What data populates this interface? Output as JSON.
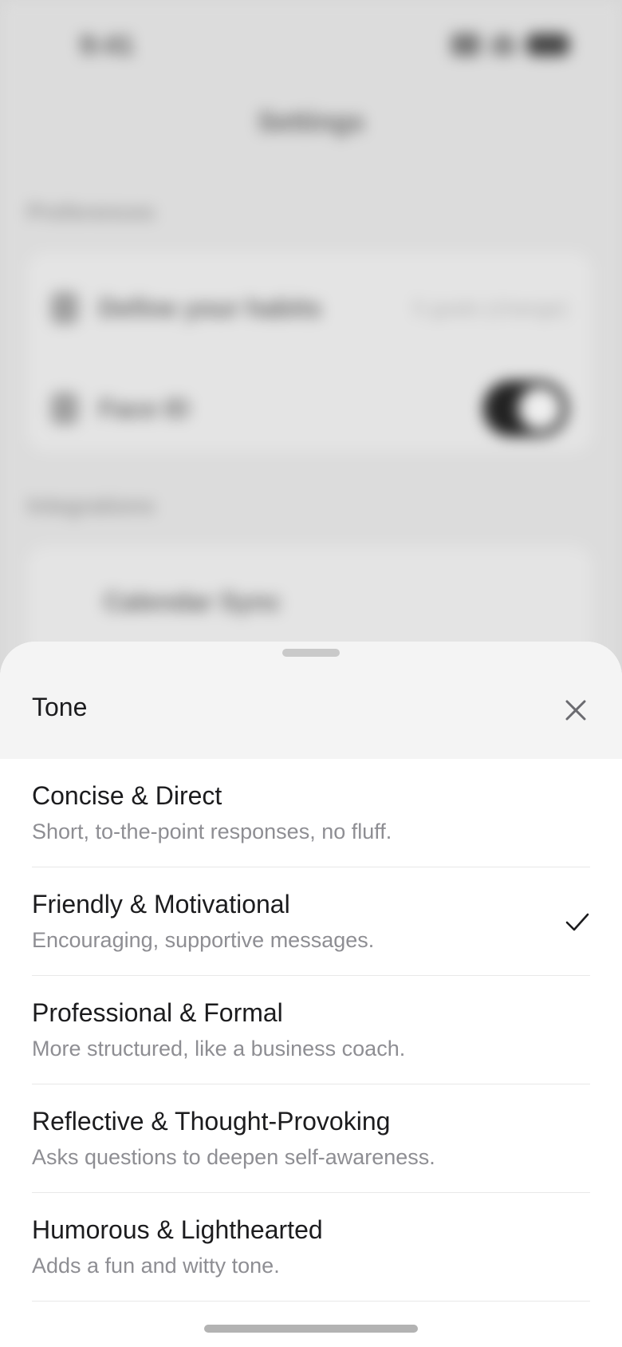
{
  "background": {
    "status_time": "9:41",
    "screen_title": "Settings",
    "section_1": "Preferences",
    "row_1_label": "Define your habits",
    "row_1_value": "5 goals (change)",
    "row_2_label": "Face ID",
    "section_2": "Integrations",
    "row_3_label": "Calendar Sync"
  },
  "sheet": {
    "title": "Tone",
    "options": [
      {
        "title": "Concise & Direct",
        "description": "Short, to-the-point responses, no fluff.",
        "selected": false
      },
      {
        "title": "Friendly & Motivational",
        "description": "Encouraging, supportive messages.",
        "selected": true
      },
      {
        "title": "Professional & Formal",
        "description": "More structured, like a business coach.",
        "selected": false
      },
      {
        "title": "Reflective & Thought-Provoking",
        "description": "Asks questions to deepen self-awareness.",
        "selected": false
      },
      {
        "title": "Humorous & Lighthearted",
        "description": "Adds a fun and witty tone.",
        "selected": false
      }
    ]
  },
  "icons": {
    "close": "close-icon",
    "check": "checkmark-icon"
  },
  "colors": {
    "sheet_header_bg": "#f4f4f4",
    "primary_text": "#1c1c1e",
    "secondary_text": "#8e8e93",
    "divider": "#e8e8e8"
  }
}
